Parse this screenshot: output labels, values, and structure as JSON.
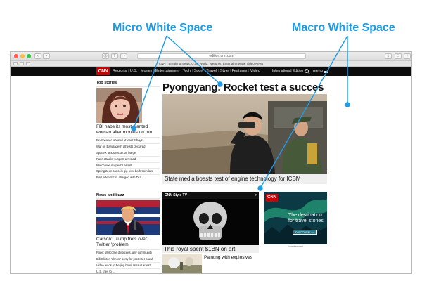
{
  "callouts": {
    "micro": "Micro White Space",
    "macro": "Macro White Space"
  },
  "browser": {
    "address": "edition.cnn.com",
    "tab_title": "CNN - Breaking News, U.S., World, Weather, Entertainment & Video News"
  },
  "cnn": {
    "logo": "CNN",
    "nav": [
      "Regions",
      "U.S.",
      "Money",
      "Entertainment",
      "Tech",
      "Sport",
      "Travel",
      "Style",
      "Features",
      "Video"
    ],
    "edition": "International Edition +",
    "menu": "menu"
  },
  "top_stories": {
    "header": "Top stories",
    "headline": "FBI nabs its most-wanted woman after months on run",
    "links": [
      "Ex-Speaker 'abused at least 4 boys'",
      "War on Bangladesh atheists declared",
      "SpaceX lands rocket on barge",
      "Paris attacks suspect arrested",
      "Watch one suspect's arrest",
      "Springsteen cancels gig over bathroom law",
      "Bin Laden SEAL charged with DUI"
    ]
  },
  "main_story": {
    "title": "Pyongyang: Rocket test a succes",
    "caption": "State media boasts test of engine technology for ICBM"
  },
  "news_buzz": {
    "header": "News and buzz",
    "headline": "Carson: Trump frets over Twitter 'problem'",
    "links": [
      "Pope: Welcome divorcees, gay community",
      "Bill Clinton 'almost' sorry for protester brawl",
      "Video leads to Beijing hotel assault arrest",
      "U.S. tries to ..."
    ]
  },
  "style_tv": {
    "header": "CNN Style TV",
    "caption": "This royal spent $1BN on art",
    "thumb_caption": "Painting with explosives"
  },
  "ad": {
    "logo": "CNN",
    "text": "The destination for travel stories",
    "button": "DISCOVER >>",
    "label": "Advertisement"
  },
  "colors": {
    "callout": "#1e9be6",
    "cnn_red": "#cc0000",
    "nav_bg": "#0c0c0c"
  }
}
